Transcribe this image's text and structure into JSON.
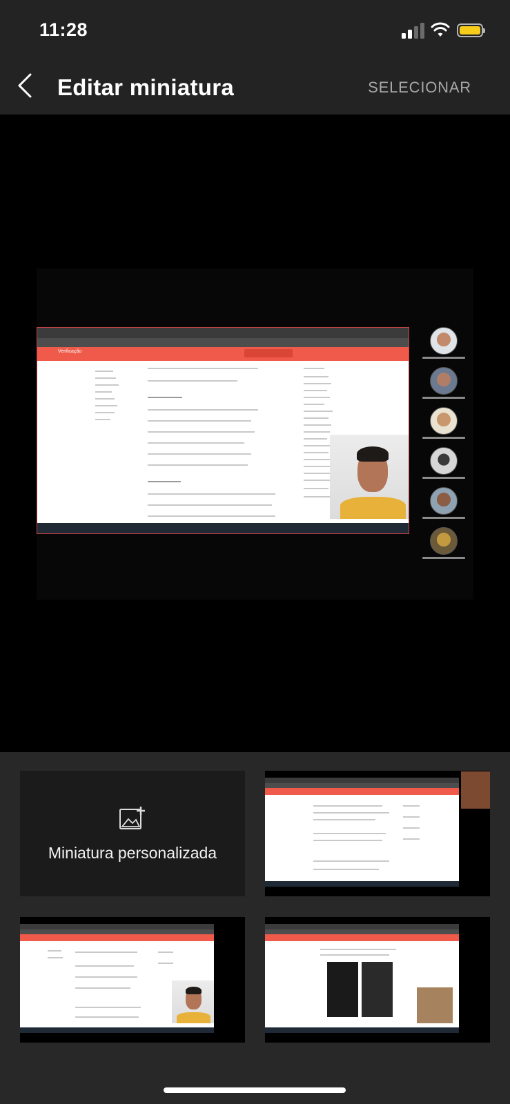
{
  "status_bar": {
    "time": "11:28"
  },
  "header": {
    "title": "Editar miniatura",
    "select_label": "SELECIONAR"
  },
  "preview": {
    "label": "Verificação"
  },
  "thumbnails": {
    "custom_label": "Miniatura personalizada"
  },
  "colors": {
    "accent": "#ef5a4a",
    "battery": "#f7cc1a",
    "background": "#282828"
  },
  "icons": [
    "chevron-left-icon",
    "signal-icon",
    "wifi-icon",
    "battery-icon",
    "add-image-icon"
  ]
}
